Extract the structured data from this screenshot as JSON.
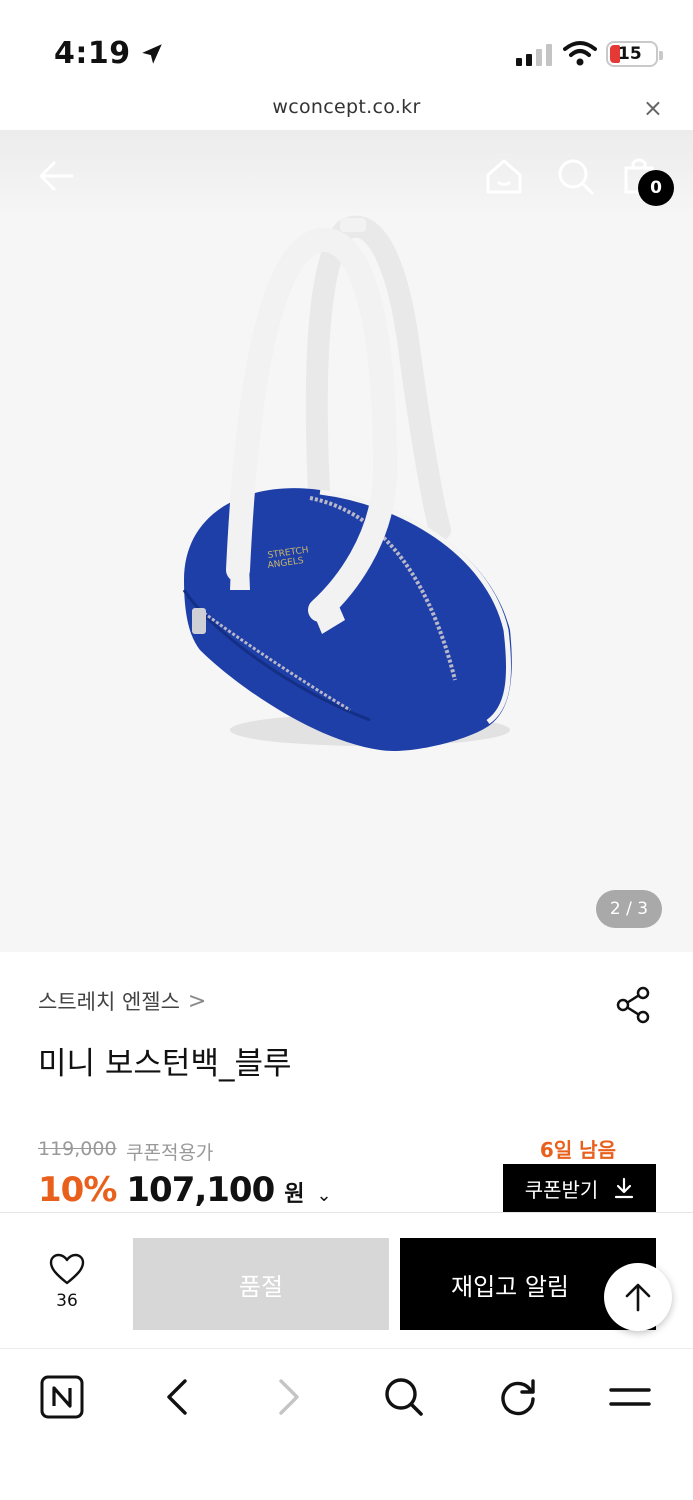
{
  "status_bar": {
    "time": "4:19",
    "battery": "15"
  },
  "browser": {
    "url": "wconcept.co.kr",
    "close_label": "×"
  },
  "header": {
    "cart_count": "0"
  },
  "gallery": {
    "indicator": "2 / 3",
    "bag_colors": {
      "body": "#1f3fa8",
      "handles": "#f2f2f2"
    }
  },
  "product": {
    "brand": "스트레치 엔젤스",
    "brand_chevron": ">",
    "title": "미니 보스턴백_블루",
    "original_price": "119,000",
    "coupon_label": "쿠폰적용가",
    "days_left": "6일 남음",
    "discount": "10%",
    "price": "107,100",
    "currency": "원",
    "currency_chevron": "⌄",
    "coupon_button": "쿠폰받기"
  },
  "actions": {
    "like_count": "36",
    "soldout_label": "품절",
    "restock_label": "재입고 알림"
  },
  "colors": {
    "accent": "#e8601c",
    "black": "#000000",
    "soldout_gray": "#d7d7d7"
  },
  "icons": [
    "back-arrow-icon",
    "home-icon",
    "search-icon",
    "shopping-bag-icon",
    "share-icon",
    "heart-icon",
    "arrow-up-icon",
    "naver-n-icon",
    "chevron-left-icon",
    "chevron-right-icon",
    "refresh-icon",
    "menu-icon",
    "location-arrow-icon",
    "download-icon"
  ]
}
